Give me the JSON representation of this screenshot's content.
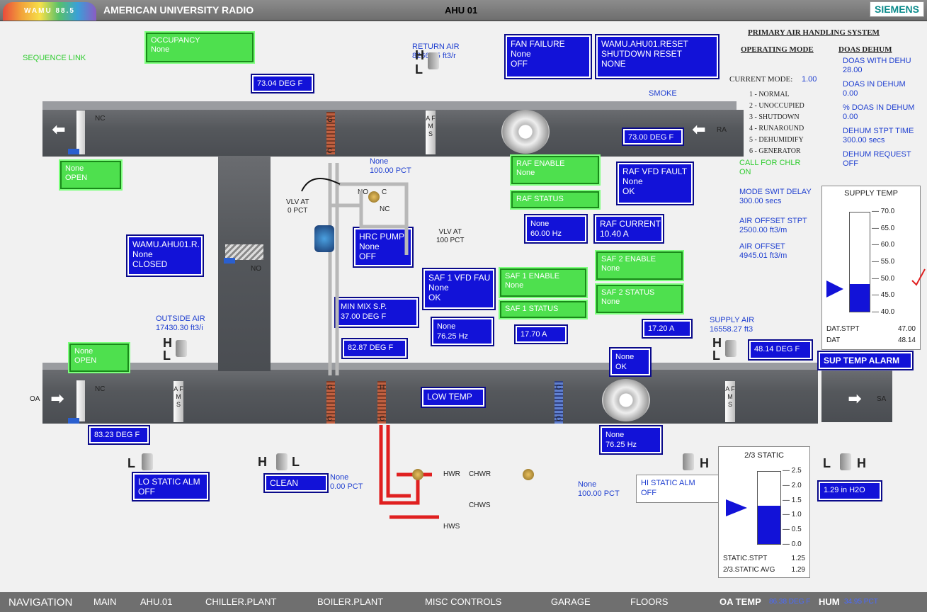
{
  "header": {
    "logo": "WAMU 88.5",
    "station": "AMERICAN UNIVERSITY RADIO",
    "unit": "AHU 01",
    "brand": "SIEMENS"
  },
  "links": {
    "sequence": "SEQUENCE LINK"
  },
  "occupancy": {
    "title": "OCCUPANCY",
    "value": "None"
  },
  "mixed_temp": "73.04 DEG F",
  "return_air": {
    "label": "RETURN AIR",
    "value": "8266.05 ft3/r"
  },
  "fan_failure": {
    "title": "FAN FAILURE",
    "line2": "None",
    "line3": "OFF"
  },
  "reset": {
    "title": "WAMU.AHU01.RESET",
    "line2": "SHUTDOWN RESET",
    "line3": "NONE"
  },
  "smoke": "SMOKE",
  "return_temp": "73.00 DEG F",
  "ra": "RA",
  "exhaust_damper": {
    "line1": "None",
    "line2": "OPEN"
  },
  "nc1": "NC",
  "g1": "G",
  "c1": "C",
  "afms1": "A F M S",
  "hrc_valve": {
    "line1": "None",
    "line2": "100.00 PCT"
  },
  "vlv_at_0": {
    "line1": "VLV AT",
    "line2": "0 PCT"
  },
  "vlv_at_100": {
    "line1": "VLV AT",
    "line2": "100 PCT"
  },
  "valve_no": "NO",
  "valve_c": "C",
  "valve_nc": "NC",
  "raf_enable": {
    "title": "RAF ENABLE",
    "value": "None"
  },
  "raf_status": "RAF STATUS",
  "raf_vfd_fault": {
    "title": "RAF VFD FAULT",
    "line2": "None",
    "line3": "OK"
  },
  "raf_hz": {
    "line1": "None",
    "line2": "60.00 Hz"
  },
  "raf_current": {
    "title": "RAF CURRENT",
    "value": "10.40 A"
  },
  "hrc_pump": {
    "title": "HRC PUMP",
    "line2": "None",
    "line3": "OFF"
  },
  "outside_damper": {
    "title": "WAMU.AHU01.R.",
    "line2": "None",
    "line3": "CLOSED"
  },
  "no1": "NO",
  "saf1_vfd": {
    "title": "SAF 1 VFD FAU",
    "line2": "None",
    "line3": "OK"
  },
  "saf1_enable": {
    "title": "SAF 1 ENABLE",
    "value": "None"
  },
  "saf1_status": "SAF 1 STATUS",
  "saf2_enable": {
    "title": "SAF 2 ENABLE",
    "value": "None"
  },
  "saf2_status": {
    "title": "SAF 2 STATUS",
    "value": "None"
  },
  "min_mix": {
    "title": "MIN MIX S.P.",
    "value": "37.00 DEG F"
  },
  "saf1_hz": {
    "line1": "None",
    "line2": "76.25 Hz"
  },
  "saf1_amps": "17.70 A",
  "saf2_amps": "17.20 A",
  "mix_temp2": "82.87 DEG F",
  "outside_air": {
    "label": "OUTSIDE AIR",
    "value": "17430.30 ft3/i"
  },
  "oa_damper": {
    "line1": "None",
    "line2": "OPEN"
  },
  "supply_air": {
    "label": "SUPPLY AIR",
    "value": "16558.27 ft3"
  },
  "supply_temp_box": "48.14 DEG F",
  "smoke_det": {
    "line1": "None",
    "line2": "OK"
  },
  "sup_alarm": "SUP TEMP ALARM",
  "low_temp": "LOW TEMP",
  "oa": "OA",
  "sa": "SA",
  "nc2": "NC",
  "g2": "G",
  "c2": "C",
  "h1": "H",
  "c3": "C",
  "c4": "C",
  "c5": "C",
  "afms2": "A F M S",
  "afms3": "A F M S",
  "oa_temp": "83.23 DEG F",
  "lo_static": {
    "title": "LO STATIC ALM",
    "value": "OFF"
  },
  "filter": "CLEAN",
  "heating_valve": {
    "line1": "None",
    "line2": "0.00 PCT"
  },
  "hwr": "HWR",
  "hws": "HWS",
  "chwr": "CHWR",
  "chws": "CHWS",
  "cooling_valve": {
    "line1": "None",
    "line2": "100.00 PCT"
  },
  "saf2_hz": {
    "line1": "None",
    "line2": "76.25 Hz"
  },
  "hi_static": {
    "title": "HI STATIC ALM",
    "value": "OFF"
  },
  "static_value": "1.29 in H2O",
  "static_gauge": {
    "title": "2/3 STATIC",
    "ticks": [
      "2.5",
      "2.0",
      "1.5",
      "1.0",
      "0.5",
      "0.0"
    ],
    "stpt_label": "STATIC.STPT",
    "stpt": "1.25",
    "avg_label": "2/3.STATIC AVG",
    "avg": "1.29",
    "fill_value": 1.29,
    "stpt_value": 1.25,
    "min": 0,
    "max": 2.5
  },
  "supply_gauge": {
    "title": "SUPPLY TEMP",
    "ticks": [
      "70.0",
      "65.0",
      "60.0",
      "55.0",
      "50.0",
      "45.0",
      "40.0"
    ],
    "stpt_label": "DAT.STPT",
    "stpt": "47.00",
    "dat_label": "DAT",
    "dat": "48.14",
    "fill_value": 48.14,
    "stpt_value": 47,
    "min": 40,
    "max": 70
  },
  "primary": {
    "title": "PRIMARY AIR HANDLING SYSTEM",
    "op_mode": "OPERATING MODE",
    "doas": "DOAS DEHUM",
    "current_mode_label": "CURRENT MODE:",
    "current_mode": "1.00",
    "modes": [
      "1 - NORMAL",
      "2 - UNOCCUPIED",
      "3 - SHUTDOWN",
      "4 - RUNAROUND",
      "5 - DEHUMIDIFY",
      "6 - GENERATOR"
    ],
    "call_chlr": "CALL FOR CHLR",
    "call_chlr_val": "ON",
    "mode_delay": "MODE SWIT DELAY",
    "mode_delay_val": "300.00 secs",
    "air_offset_stpt": "AIR OFFSET STPT",
    "air_offset_stpt_val": "2500.00 ft3/m",
    "air_offset": "AIR OFFSET",
    "air_offset_val": "4945.01 ft3/m",
    "doas_items": [
      [
        "DOAS WITH DEHU",
        "28.00"
      ],
      [
        "DOAS IN DEHUM",
        "0.00"
      ],
      [
        "% DOAS IN DEHUM",
        "0.00"
      ],
      [
        "DEHUM STPT TIME",
        "300.00 secs"
      ],
      [
        "DEHUM REQUEST",
        "OFF"
      ]
    ]
  },
  "nav": {
    "label": "NAVIGATION",
    "items": [
      "MAIN",
      "AHU.01",
      "CHILLER.PLANT",
      "BOILER.PLANT",
      "MISC CONTROLS",
      "GARAGE",
      "FLOORS"
    ],
    "oa_temp_label": "OA TEMP",
    "oa_temp": "86.38 DEG F",
    "hum_label": "HUM",
    "hum": "34.95 PCT"
  },
  "hl": {
    "h": "H",
    "l": "L"
  },
  "colors": {
    "green": "#4ee04e",
    "blue": "#1212d8",
    "label_blue": "#1f3fd0",
    "duct": "#55585c",
    "hot": "#e02020",
    "cold": "#2060e0"
  },
  "icons": {
    "check": "check-mark-icon"
  }
}
